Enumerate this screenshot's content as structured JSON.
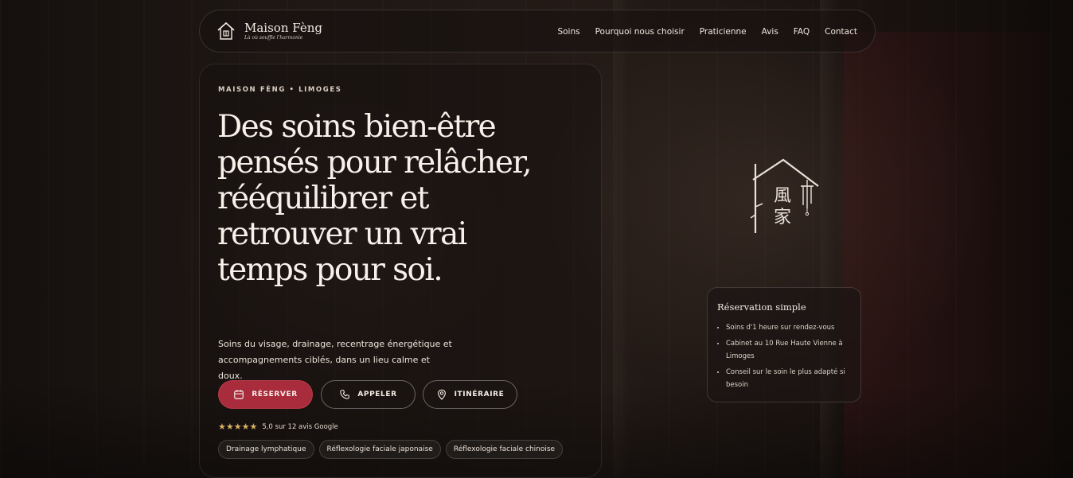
{
  "brand": {
    "name": "Maison Fèng",
    "tagline": "Là où souffle l'harmonie"
  },
  "nav": {
    "links": [
      "Soins",
      "Pourquoi nous choisir",
      "Praticienne",
      "Avis",
      "FAQ",
      "Contact"
    ]
  },
  "hero": {
    "eyebrow": "MAISON FÈNG • LIMOGES",
    "headline": "Des soins bien-être pensés pour relâcher, rééquilibrer et retrouver un vrai temps pour soi.",
    "subtitle": "Soins du visage, drainage, recentrage énergétique et accompagnements ciblés, dans un lieu calme et doux.",
    "buttons": {
      "reserve": "RÉSERVER",
      "call": "APPELER",
      "directions": "ITINÉRAIRE"
    },
    "rating": {
      "stars": 5,
      "text": "5,0 sur 12 avis Google"
    },
    "chips": [
      "Drainage lymphatique",
      "Réflexologie faciale japonaise",
      "Réflexologie faciale chinoise"
    ]
  },
  "emblem": {
    "chars": [
      "風",
      "家"
    ]
  },
  "reservation": {
    "title": "Réservation simple",
    "items": [
      "Soins d'1 heure sur rendez-vous",
      "Cabinet au 10 Rue Haute Vienne à Limoges",
      "Conseil sur le soin le plus adapté si besoin"
    ]
  },
  "colors": {
    "accent": "#a92c3d",
    "star": "#d8b062",
    "background": "#120e0c"
  },
  "icons": [
    "house-logo-icon",
    "calendar-icon",
    "phone-icon",
    "map-pin-icon",
    "star-icon",
    "house-emblem-icon"
  ]
}
